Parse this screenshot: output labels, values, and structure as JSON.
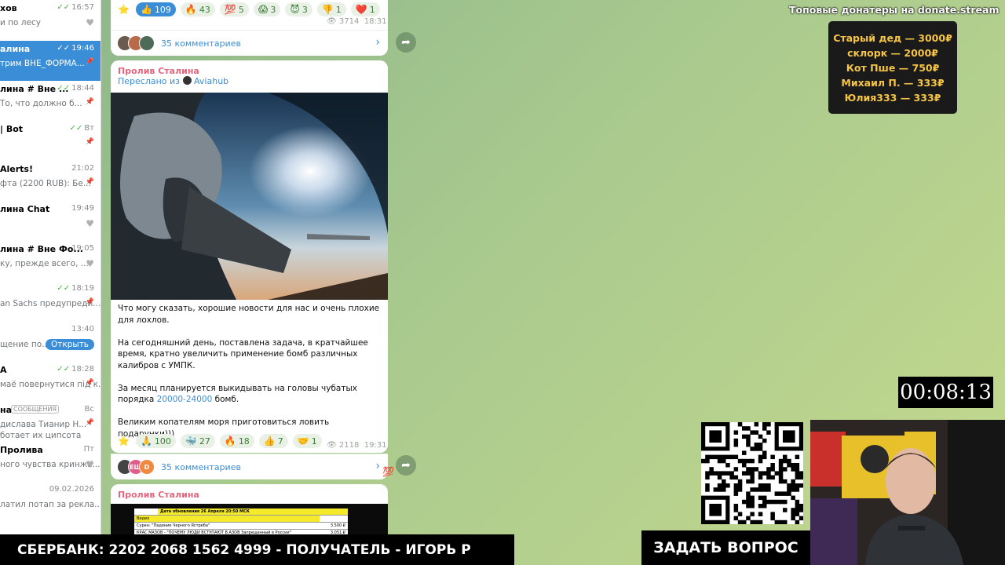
{
  "chat_list": {
    "items": [
      {
        "name": "хов",
        "preview": "и по лесу",
        "time": "16:57",
        "check": true,
        "side": "heart"
      },
      {
        "name": "алина",
        "preview": "трим ВНЕ_ФОРМА...",
        "time": "19:46",
        "check": true,
        "side": "pin",
        "active": true
      },
      {
        "name": "лина # Вне ...",
        "preview": "То, что должно б...",
        "time": "18:44",
        "check": true,
        "side": "pin"
      },
      {
        "name": "| Bot",
        "preview": "",
        "time": "Вт",
        "check": true,
        "side": "pin"
      },
      {
        "name": "Alerts!",
        "preview": "фта (2200 RUB): Бе...",
        "time": "21:02",
        "check": false,
        "side": "pin"
      },
      {
        "name": "лина Chat",
        "preview": "",
        "time": "19:49",
        "check": false,
        "side": "heart"
      },
      {
        "name": "лина # Вне Фо...",
        "preview": "ку, прежде всего, ...",
        "time": "19:05",
        "check": false,
        "side": "heart"
      },
      {
        "name": "",
        "preview": "an Sachs предупреди...",
        "time": "18:19",
        "check": true,
        "side": "pin"
      },
      {
        "name": "",
        "preview": "щение по...",
        "time": "13:40",
        "check": false,
        "side": "open",
        "open_label": "Открыть"
      },
      {
        "name": "A",
        "preview": "маё повернутися під к...",
        "time": "18:28",
        "check": true,
        "side": "pin"
      },
      {
        "name": "на",
        "badge": "СООБЩЕНИЯ",
        "preview": "дислава  Тианир Н...",
        "time": "Вс",
        "check": false,
        "side": "pin",
        "extra": "ботает их ципсота"
      },
      {
        "name": "Пролива",
        "preview": "ного чувства кринжа...",
        "time": "Пт",
        "check": false,
        "side": "heart"
      },
      {
        "name": "",
        "preview": "латил потап за рекла...",
        "time": "09.02.2026",
        "check": false,
        "side": ""
      }
    ]
  },
  "post_top": {
    "reactions": [
      {
        "emoji": "⭐",
        "count": ""
      },
      {
        "emoji": "👍",
        "count": "109",
        "highlight": true
      },
      {
        "emoji": "🔥",
        "count": "43"
      },
      {
        "emoji": "💯",
        "count": "5"
      },
      {
        "emoji": "😱",
        "count": "3"
      },
      {
        "emoji": "😈",
        "count": "3"
      },
      {
        "emoji": "👎",
        "count": "1"
      },
      {
        "emoji": "❤️",
        "count": "1"
      }
    ],
    "views": "3714",
    "time": "18:31",
    "comments": "35 комментариев"
  },
  "post_main": {
    "channel": "Пролив Сталина",
    "forwarded_prefix": "Переслано из",
    "forwarded_source": "Aviahub",
    "paragraphs": [
      "Что могу сказать, хорошие новости для нас и очень плохие для лохлов.",
      "На сегодняшний день, поставлена задача, в кратчайшее время, кратно увеличить применение бомб различных калибров с УМПК.",
      "Великим копателям моря приготовиться ловить подарунки)))"
    ],
    "p3_before": "За месяц планируется выкидывать на головы чубатых порядка",
    "p3_link": "20000-24000",
    "p3_after": "бомб.",
    "reactions": [
      {
        "emoji": "⭐",
        "count": ""
      },
      {
        "emoji": "🙏",
        "count": "100"
      },
      {
        "emoji": "🐳",
        "count": "27"
      },
      {
        "emoji": "🔥",
        "count": "18"
      },
      {
        "emoji": "👍",
        "count": "7"
      },
      {
        "emoji": "🤝",
        "count": "1"
      }
    ],
    "views": "2118",
    "time": "19:31",
    "comments": "35 комментариев",
    "avatar_labels": [
      "",
      "ЕЩ",
      "D"
    ]
  },
  "post_bottom": {
    "channel": "Пролив Сталина",
    "doc_header": "Дата обновления 26 Апреля 20:50 МСК",
    "doc_rows": [
      {
        "label": "Видео",
        "value": ""
      },
      {
        "label": "Сурен: \"Падение Черного Ястреба\"",
        "value": "3.500 ₽"
      },
      {
        "label": "КРАС МАЗОВ - \"ПОЧЕМУ ЛЮДИ ВСТУПАЮТ В АЗОВ Запрещенный в России\"",
        "value": "3.051 ₽"
      }
    ]
  },
  "overlays": {
    "donors_title": "Топовые донатеры на donate.stream",
    "donors": [
      "Старый дед — 3000₽",
      "склорк — 2000₽",
      "Кот Пше — 750₽",
      "Михаил П. — 333₽",
      "Юлия333 — 333₽"
    ],
    "timer": "00:08:13",
    "bank_banner": "СБЕРБАНК: 2202 2068 1562 4999 - ПОЛУЧАТЕЛЬ - ИГОРЬ Р",
    "ask_banner": "ЗАДАТЬ ВОПРОС"
  },
  "colors": {
    "accent": "#3a8ed8",
    "channel": "#e0677f",
    "donor_text": "#f6c545"
  }
}
